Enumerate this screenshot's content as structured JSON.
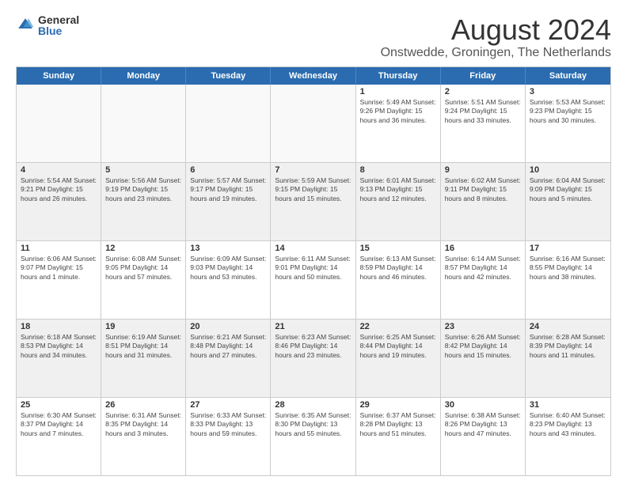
{
  "logo": {
    "general": "General",
    "blue": "Blue"
  },
  "title": "August 2024",
  "subtitle": "Onstwedde, Groningen, The Netherlands",
  "weekdays": [
    "Sunday",
    "Monday",
    "Tuesday",
    "Wednesday",
    "Thursday",
    "Friday",
    "Saturday"
  ],
  "rows": [
    [
      {
        "day": "",
        "empty": true
      },
      {
        "day": "",
        "empty": true
      },
      {
        "day": "",
        "empty": true
      },
      {
        "day": "",
        "empty": true
      },
      {
        "day": "1",
        "detail": "Sunrise: 5:49 AM\nSunset: 9:26 PM\nDaylight: 15 hours\nand 36 minutes."
      },
      {
        "day": "2",
        "detail": "Sunrise: 5:51 AM\nSunset: 9:24 PM\nDaylight: 15 hours\nand 33 minutes."
      },
      {
        "day": "3",
        "detail": "Sunrise: 5:53 AM\nSunset: 9:23 PM\nDaylight: 15 hours\nand 30 minutes."
      }
    ],
    [
      {
        "day": "4",
        "detail": "Sunrise: 5:54 AM\nSunset: 9:21 PM\nDaylight: 15 hours\nand 26 minutes."
      },
      {
        "day": "5",
        "detail": "Sunrise: 5:56 AM\nSunset: 9:19 PM\nDaylight: 15 hours\nand 23 minutes."
      },
      {
        "day": "6",
        "detail": "Sunrise: 5:57 AM\nSunset: 9:17 PM\nDaylight: 15 hours\nand 19 minutes."
      },
      {
        "day": "7",
        "detail": "Sunrise: 5:59 AM\nSunset: 9:15 PM\nDaylight: 15 hours\nand 15 minutes."
      },
      {
        "day": "8",
        "detail": "Sunrise: 6:01 AM\nSunset: 9:13 PM\nDaylight: 15 hours\nand 12 minutes."
      },
      {
        "day": "9",
        "detail": "Sunrise: 6:02 AM\nSunset: 9:11 PM\nDaylight: 15 hours\nand 8 minutes."
      },
      {
        "day": "10",
        "detail": "Sunrise: 6:04 AM\nSunset: 9:09 PM\nDaylight: 15 hours\nand 5 minutes."
      }
    ],
    [
      {
        "day": "11",
        "detail": "Sunrise: 6:06 AM\nSunset: 9:07 PM\nDaylight: 15 hours\nand 1 minute."
      },
      {
        "day": "12",
        "detail": "Sunrise: 6:08 AM\nSunset: 9:05 PM\nDaylight: 14 hours\nand 57 minutes."
      },
      {
        "day": "13",
        "detail": "Sunrise: 6:09 AM\nSunset: 9:03 PM\nDaylight: 14 hours\nand 53 minutes."
      },
      {
        "day": "14",
        "detail": "Sunrise: 6:11 AM\nSunset: 9:01 PM\nDaylight: 14 hours\nand 50 minutes."
      },
      {
        "day": "15",
        "detail": "Sunrise: 6:13 AM\nSunset: 8:59 PM\nDaylight: 14 hours\nand 46 minutes."
      },
      {
        "day": "16",
        "detail": "Sunrise: 6:14 AM\nSunset: 8:57 PM\nDaylight: 14 hours\nand 42 minutes."
      },
      {
        "day": "17",
        "detail": "Sunrise: 6:16 AM\nSunset: 8:55 PM\nDaylight: 14 hours\nand 38 minutes."
      }
    ],
    [
      {
        "day": "18",
        "detail": "Sunrise: 6:18 AM\nSunset: 8:53 PM\nDaylight: 14 hours\nand 34 minutes."
      },
      {
        "day": "19",
        "detail": "Sunrise: 6:19 AM\nSunset: 8:51 PM\nDaylight: 14 hours\nand 31 minutes."
      },
      {
        "day": "20",
        "detail": "Sunrise: 6:21 AM\nSunset: 8:48 PM\nDaylight: 14 hours\nand 27 minutes."
      },
      {
        "day": "21",
        "detail": "Sunrise: 6:23 AM\nSunset: 8:46 PM\nDaylight: 14 hours\nand 23 minutes."
      },
      {
        "day": "22",
        "detail": "Sunrise: 6:25 AM\nSunset: 8:44 PM\nDaylight: 14 hours\nand 19 minutes."
      },
      {
        "day": "23",
        "detail": "Sunrise: 6:26 AM\nSunset: 8:42 PM\nDaylight: 14 hours\nand 15 minutes."
      },
      {
        "day": "24",
        "detail": "Sunrise: 6:28 AM\nSunset: 8:39 PM\nDaylight: 14 hours\nand 11 minutes."
      }
    ],
    [
      {
        "day": "25",
        "detail": "Sunrise: 6:30 AM\nSunset: 8:37 PM\nDaylight: 14 hours\nand 7 minutes."
      },
      {
        "day": "26",
        "detail": "Sunrise: 6:31 AM\nSunset: 8:35 PM\nDaylight: 14 hours\nand 3 minutes."
      },
      {
        "day": "27",
        "detail": "Sunrise: 6:33 AM\nSunset: 8:33 PM\nDaylight: 13 hours\nand 59 minutes."
      },
      {
        "day": "28",
        "detail": "Sunrise: 6:35 AM\nSunset: 8:30 PM\nDaylight: 13 hours\nand 55 minutes."
      },
      {
        "day": "29",
        "detail": "Sunrise: 6:37 AM\nSunset: 8:28 PM\nDaylight: 13 hours\nand 51 minutes."
      },
      {
        "day": "30",
        "detail": "Sunrise: 6:38 AM\nSunset: 8:26 PM\nDaylight: 13 hours\nand 47 minutes."
      },
      {
        "day": "31",
        "detail": "Sunrise: 6:40 AM\nSunset: 8:23 PM\nDaylight: 13 hours\nand 43 minutes."
      }
    ]
  ]
}
